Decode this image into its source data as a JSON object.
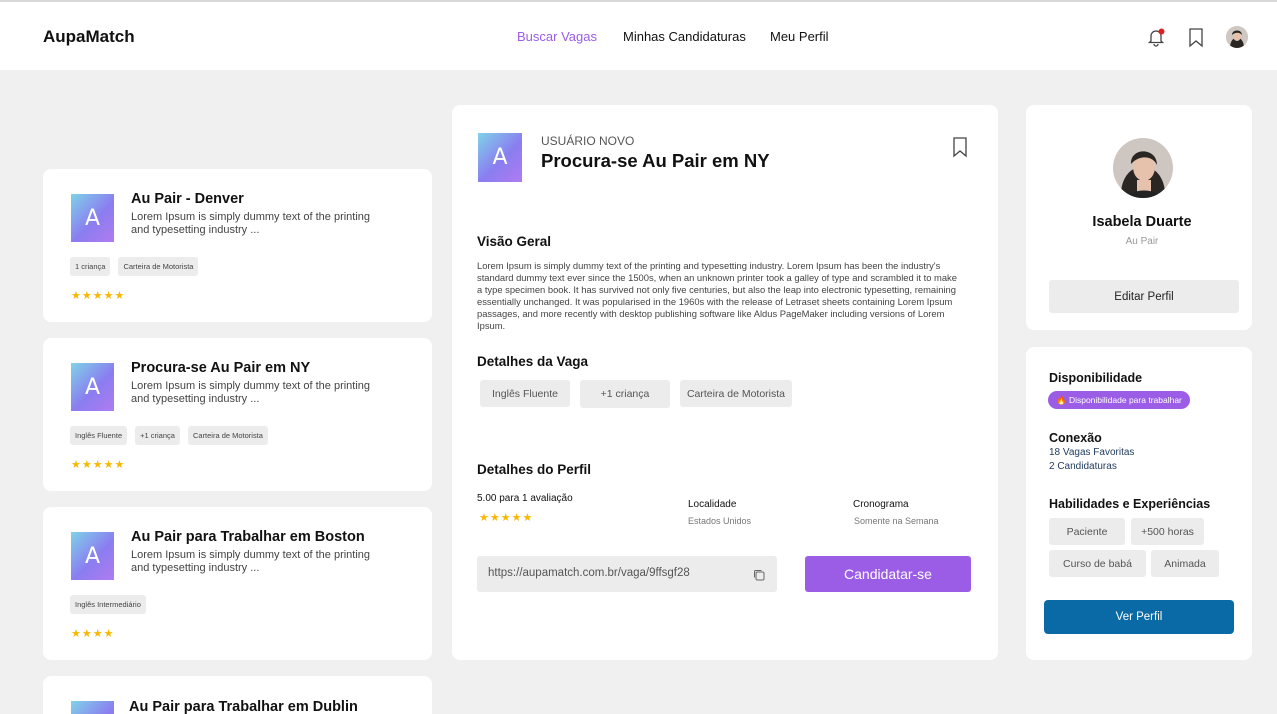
{
  "header": {
    "logo": "AupaMatch",
    "nav": [
      "Buscar Vagas",
      "Minhas Candidaturas",
      "Meu Perfil"
    ]
  },
  "jobs": [
    {
      "title": "Au Pair - Denver",
      "desc": "Lorem Ipsum is simply dummy text of the printing and typesetting industry ...",
      "tags": [
        "1 criança",
        "Carteira de Motorista"
      ],
      "stars": "★★★★★",
      "rating": 5
    },
    {
      "title": "Procura-se Au Pair em NY",
      "desc": "Lorem Ipsum is simply dummy text of the printing and typesetting industry ...",
      "tags": [
        "Inglês Fluente",
        "+1 criança",
        "Carteira de Motorista"
      ],
      "stars": "★★★★★",
      "rating": 5
    },
    {
      "title": "Au Pair para Trabalhar em Boston",
      "desc": "Lorem Ipsum is simply dummy text of the printing and typesetting industry ...",
      "tags": [
        "Inglês Intermediário"
      ],
      "stars": "★★★★",
      "rating": 4
    },
    {
      "title": "Au Pair para Trabalhar em Dublin"
    }
  ],
  "logo_letter": "A",
  "detail": {
    "badge": "USUÁRIO NOVO",
    "title": "Procura-se Au Pair em NY",
    "overview_title": "Visão Geral",
    "overview_text": "Lorem Ipsum is simply dummy text of the printing and typesetting industry. Lorem Ipsum has been the industry's standard dummy text ever since the 1500s, when an unknown printer took a galley of type and scrambled it to make a type specimen book. It has survived not only five centuries, but also the leap into electronic typesetting, remaining essentially unchanged. It was popularised in the 1960s with the release of Letraset sheets containing Lorem Ipsum passages, and more recently with desktop publishing software like Aldus PageMaker including versions of Lorem Ipsum.",
    "details_title": "Detalhes da Vaga",
    "chips": [
      "Inglês Fluente",
      "+1 criança",
      "Carteira de Motorista"
    ],
    "profile_title": "Detalhes do Perfil",
    "rating_text": "5.00 para 1 avaliação",
    "stars": "★★★★★",
    "location_label": "Localidade",
    "location_value": "Estados Unidos",
    "schedule_label": "Cronograma",
    "schedule_value": "Somente na Semana",
    "url": "https://aupamatch.com.br/vaga/9ffsgf28",
    "apply": "Candidatar-se"
  },
  "profile": {
    "name": "Isabela Duarte",
    "role": "Au Pair",
    "edit": "Editar Perfil"
  },
  "side": {
    "availability_title": "Disponibilidade",
    "availability_badge": "🔥 Disponibilidade para trabalhar",
    "connection_title": "Conexão",
    "favorites": "18 Vagas Favoritas",
    "applications": "2 Candidaturas",
    "skills_title": "Habilidades e Experiências",
    "skills": [
      "Paciente",
      "+500 horas",
      "Curso de babá",
      "Animada"
    ],
    "view_profile": "Ver Perfil"
  },
  "colors": {
    "accent": "#9b5de5",
    "primary_button": "#0a6aa6",
    "star": "#f6b800"
  }
}
